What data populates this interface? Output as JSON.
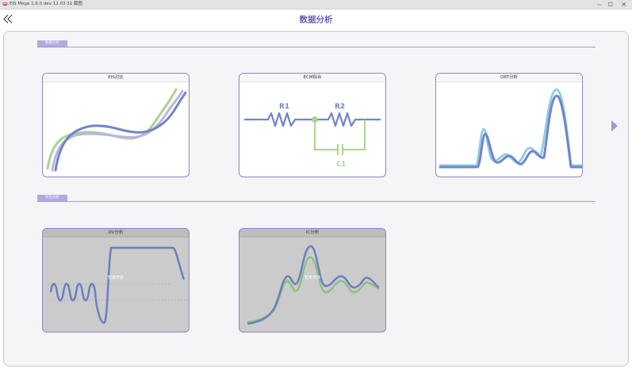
{
  "window": {
    "title": "EIS Mega 1.6.0 dev 12 03 31   截图",
    "icons": [
      "app-icon",
      "minimize-icon",
      "maximize-icon",
      "close-icon"
    ]
  },
  "header": {
    "title": "数据分析",
    "back_icon": "double-chevron-left-icon"
  },
  "sections": [
    {
      "label": "数据分析",
      "cards": [
        {
          "title": "EIS对比",
          "enabled": true
        },
        {
          "title": "ECM拟合",
          "enabled": true,
          "labels": [
            "R1",
            "R2",
            "C1"
          ]
        },
        {
          "title": "DRT分析",
          "enabled": true
        }
      ]
    },
    {
      "label": "对比分析",
      "cards": [
        {
          "title": "DV分析",
          "enabled": false,
          "overlay": "暂未开放"
        },
        {
          "title": "IC分析",
          "enabled": false,
          "overlay": "暂未开放"
        }
      ]
    }
  ],
  "navigation": {
    "next_icon": "triangle-right-icon"
  },
  "colors": {
    "accent": "#6a5fb0",
    "blue": "#7284c7",
    "green": "#a7d491",
    "lavender": "#b9b4e3",
    "cyan": "#8fd0e6",
    "card_border": "#8d86c9"
  }
}
